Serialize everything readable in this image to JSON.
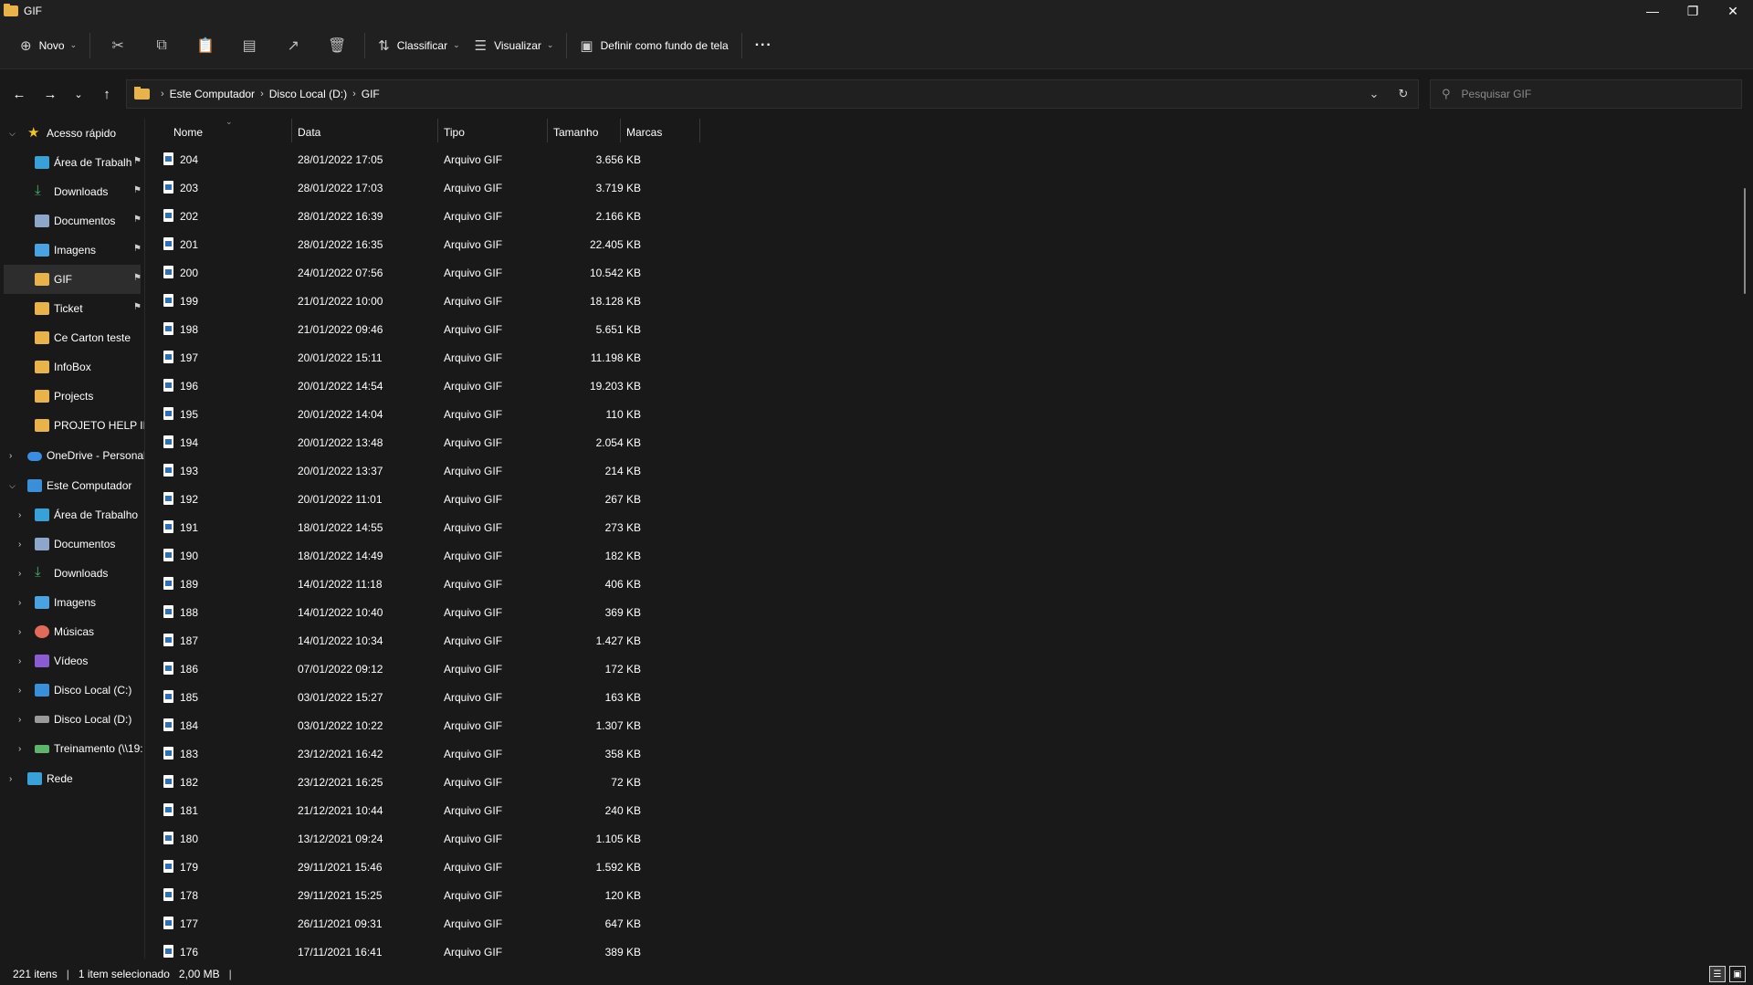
{
  "window": {
    "title": "GIF"
  },
  "toolbar": {
    "new_label": "Novo",
    "sort_label": "Classificar",
    "view_label": "Visualizar",
    "wallpaper_label": "Definir como fundo de tela",
    "more_label": "···"
  },
  "address": {
    "crumbs": [
      "Este Computador",
      "Disco Local (D:)",
      "GIF"
    ],
    "search_placeholder": "Pesquisar GIF"
  },
  "sidebar": {
    "items": [
      {
        "label": "Acesso rápido",
        "icon": "star-icon",
        "level": 0,
        "expander": "expanded",
        "pinned": false,
        "selected": false
      },
      {
        "label": "Área de Trabalh",
        "icon": "desktop-icon",
        "level": 1,
        "expander": "none",
        "pinned": true,
        "selected": false
      },
      {
        "label": "Downloads",
        "icon": "download-icon",
        "level": 1,
        "expander": "none",
        "pinned": true,
        "selected": false
      },
      {
        "label": "Documentos",
        "icon": "documents-icon",
        "level": 1,
        "expander": "none",
        "pinned": true,
        "selected": false
      },
      {
        "label": "Imagens",
        "icon": "pictures-icon",
        "level": 1,
        "expander": "none",
        "pinned": true,
        "selected": false
      },
      {
        "label": "GIF",
        "icon": "folder-icon",
        "level": 1,
        "expander": "none",
        "pinned": true,
        "selected": true
      },
      {
        "label": "Ticket",
        "icon": "folder-icon",
        "level": 1,
        "expander": "none",
        "pinned": true,
        "selected": false
      },
      {
        "label": "Ce Carton teste",
        "icon": "folder-icon",
        "level": 1,
        "expander": "none",
        "pinned": false,
        "selected": false
      },
      {
        "label": "InfoBox",
        "icon": "folder-icon",
        "level": 1,
        "expander": "none",
        "pinned": false,
        "selected": false
      },
      {
        "label": "Projects",
        "icon": "folder-icon",
        "level": 1,
        "expander": "none",
        "pinned": false,
        "selected": false
      },
      {
        "label": "PROJETO HELP INF",
        "icon": "folder-icon",
        "level": 1,
        "expander": "none",
        "pinned": false,
        "selected": false
      },
      {
        "label": "OneDrive - Personal",
        "icon": "onedrive-icon",
        "level": 0,
        "expander": "collapsed",
        "pinned": false,
        "selected": false,
        "gap": true
      },
      {
        "label": "Este Computador",
        "icon": "computer-icon",
        "level": 0,
        "expander": "expanded",
        "pinned": false,
        "selected": false,
        "gap": true
      },
      {
        "label": "Área de Trabalho",
        "icon": "desktop-icon",
        "level": 1,
        "expander": "collapsed",
        "pinned": false,
        "selected": false
      },
      {
        "label": "Documentos",
        "icon": "documents-icon",
        "level": 1,
        "expander": "collapsed",
        "pinned": false,
        "selected": false
      },
      {
        "label": "Downloads",
        "icon": "download-icon",
        "level": 1,
        "expander": "collapsed",
        "pinned": false,
        "selected": false
      },
      {
        "label": "Imagens",
        "icon": "pictures-icon",
        "level": 1,
        "expander": "collapsed",
        "pinned": false,
        "selected": false
      },
      {
        "label": "Músicas",
        "icon": "music-icon",
        "level": 1,
        "expander": "collapsed",
        "pinned": false,
        "selected": false
      },
      {
        "label": "Vídeos",
        "icon": "videos-icon",
        "level": 1,
        "expander": "collapsed",
        "pinned": false,
        "selected": false
      },
      {
        "label": "Disco Local (C:)",
        "icon": "windows-drive-icon",
        "level": 1,
        "expander": "collapsed",
        "pinned": false,
        "selected": false
      },
      {
        "label": "Disco Local (D:)",
        "icon": "drive-icon",
        "level": 1,
        "expander": "collapsed",
        "pinned": false,
        "selected": false
      },
      {
        "label": "Treinamento (\\\\19:",
        "icon": "network-drive-icon",
        "level": 1,
        "expander": "collapsed",
        "pinned": false,
        "selected": false
      },
      {
        "label": "Rede",
        "icon": "network-icon",
        "level": 0,
        "expander": "collapsed",
        "pinned": false,
        "selected": false,
        "gap": true
      }
    ]
  },
  "columns": {
    "name": "Nome",
    "date": "Data",
    "type": "Tipo",
    "size": "Tamanho",
    "tags": "Marcas"
  },
  "files": [
    {
      "name": "204",
      "date": "28/01/2022 17:05",
      "type": "Arquivo GIF",
      "size": "3.656 KB"
    },
    {
      "name": "203",
      "date": "28/01/2022 17:03",
      "type": "Arquivo GIF",
      "size": "3.719 KB"
    },
    {
      "name": "202",
      "date": "28/01/2022 16:39",
      "type": "Arquivo GIF",
      "size": "2.166 KB"
    },
    {
      "name": "201",
      "date": "28/01/2022 16:35",
      "type": "Arquivo GIF",
      "size": "22.405 KB"
    },
    {
      "name": "200",
      "date": "24/01/2022 07:56",
      "type": "Arquivo GIF",
      "size": "10.542 KB"
    },
    {
      "name": "199",
      "date": "21/01/2022 10:00",
      "type": "Arquivo GIF",
      "size": "18.128 KB"
    },
    {
      "name": "198",
      "date": "21/01/2022 09:46",
      "type": "Arquivo GIF",
      "size": "5.651 KB"
    },
    {
      "name": "197",
      "date": "20/01/2022 15:11",
      "type": "Arquivo GIF",
      "size": "11.198 KB"
    },
    {
      "name": "196",
      "date": "20/01/2022 14:54",
      "type": "Arquivo GIF",
      "size": "19.203 KB"
    },
    {
      "name": "195",
      "date": "20/01/2022 14:04",
      "type": "Arquivo GIF",
      "size": "110 KB"
    },
    {
      "name": "194",
      "date": "20/01/2022 13:48",
      "type": "Arquivo GIF",
      "size": "2.054 KB"
    },
    {
      "name": "193",
      "date": "20/01/2022 13:37",
      "type": "Arquivo GIF",
      "size": "214 KB"
    },
    {
      "name": "192",
      "date": "20/01/2022 11:01",
      "type": "Arquivo GIF",
      "size": "267 KB"
    },
    {
      "name": "191",
      "date": "18/01/2022 14:55",
      "type": "Arquivo GIF",
      "size": "273 KB"
    },
    {
      "name": "190",
      "date": "18/01/2022 14:49",
      "type": "Arquivo GIF",
      "size": "182 KB"
    },
    {
      "name": "189",
      "date": "14/01/2022 11:18",
      "type": "Arquivo GIF",
      "size": "406 KB"
    },
    {
      "name": "188",
      "date": "14/01/2022 10:40",
      "type": "Arquivo GIF",
      "size": "369 KB"
    },
    {
      "name": "187",
      "date": "14/01/2022 10:34",
      "type": "Arquivo GIF",
      "size": "1.427 KB"
    },
    {
      "name": "186",
      "date": "07/01/2022 09:12",
      "type": "Arquivo GIF",
      "size": "172 KB"
    },
    {
      "name": "185",
      "date": "03/01/2022 15:27",
      "type": "Arquivo GIF",
      "size": "163 KB"
    },
    {
      "name": "184",
      "date": "03/01/2022 10:22",
      "type": "Arquivo GIF",
      "size": "1.307 KB"
    },
    {
      "name": "183",
      "date": "23/12/2021 16:42",
      "type": "Arquivo GIF",
      "size": "358 KB"
    },
    {
      "name": "182",
      "date": "23/12/2021 16:25",
      "type": "Arquivo GIF",
      "size": "72 KB"
    },
    {
      "name": "181",
      "date": "21/12/2021 10:44",
      "type": "Arquivo GIF",
      "size": "240 KB"
    },
    {
      "name": "180",
      "date": "13/12/2021 09:24",
      "type": "Arquivo GIF",
      "size": "1.105 KB"
    },
    {
      "name": "179",
      "date": "29/11/2021 15:46",
      "type": "Arquivo GIF",
      "size": "1.592 KB"
    },
    {
      "name": "178",
      "date": "29/11/2021 15:25",
      "type": "Arquivo GIF",
      "size": "120 KB"
    },
    {
      "name": "177",
      "date": "26/11/2021 09:31",
      "type": "Arquivo GIF",
      "size": "647 KB"
    },
    {
      "name": "176",
      "date": "17/11/2021 16:41",
      "type": "Arquivo GIF",
      "size": "389 KB"
    }
  ],
  "status": {
    "item_count": "221 itens",
    "selection": "1 item selecionado",
    "selection_size": "2,00 MB"
  }
}
